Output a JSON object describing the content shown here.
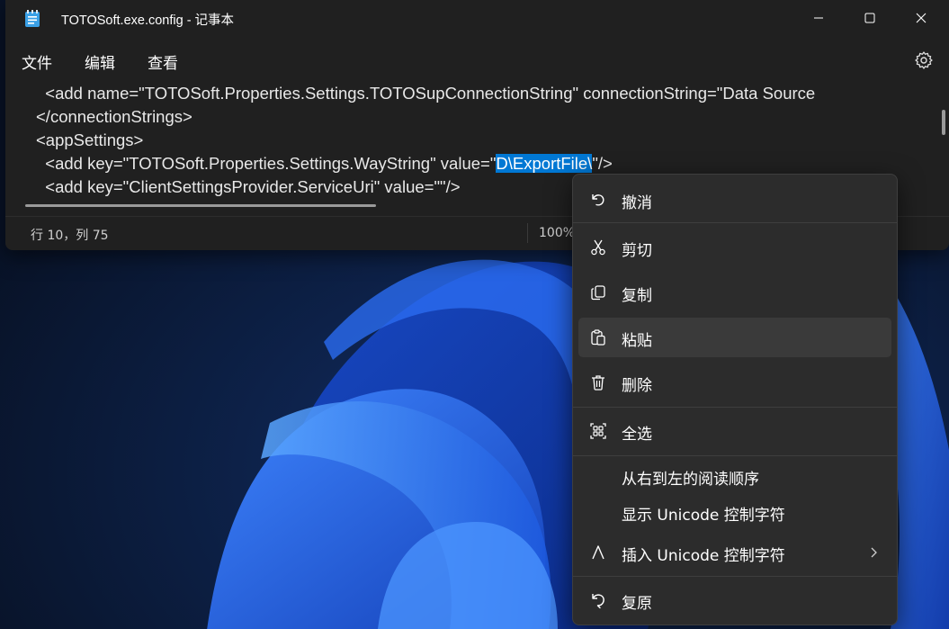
{
  "window": {
    "title": "TOTOSoft.exe.config - 记事本",
    "menu": [
      "文件",
      "编辑",
      "查看"
    ]
  },
  "editor": {
    "lines": [
      {
        "pre": "  <add name=\"TOTOSoft.Properties.Settings.TOTOSupConnectionString\" connectionString=\"Data Source",
        "sel": "",
        "post": ""
      },
      {
        "pre": "</connectionStrings>",
        "sel": "",
        "post": ""
      },
      {
        "pre": "<appSettings>",
        "sel": "",
        "post": ""
      },
      {
        "pre": "  <add key=\"TOTOSoft.Properties.Settings.WayString\" value=\"",
        "sel": "D\\ExportFile\\",
        "post": "\"/>"
      },
      {
        "pre": "  <add key=\"ClientSettingsProvider.ServiceUri\" value=\"\"/>",
        "sel": "",
        "post": ""
      }
    ]
  },
  "status": {
    "position": "行 10，列 75",
    "zoom": "100%"
  },
  "context_menu": {
    "items": [
      {
        "label": "撤消",
        "icon": "undo-icon"
      },
      {
        "label": "剪切",
        "icon": "cut-icon"
      },
      {
        "label": "复制",
        "icon": "copy-icon"
      },
      {
        "label": "粘贴",
        "icon": "paste-icon"
      },
      {
        "label": "删除",
        "icon": "delete-icon"
      },
      {
        "label": "全选",
        "icon": "select-all-icon"
      },
      {
        "label": "从右到左的阅读顺序",
        "icon": ""
      },
      {
        "label": "显示 Unicode 控制字符",
        "icon": ""
      },
      {
        "label": "插入 Unicode 控制字符",
        "icon": "insert-unicode-icon"
      },
      {
        "label": "复原",
        "icon": "reconvert-icon"
      }
    ],
    "hovered": "粘贴"
  },
  "colors": {
    "selection": "#0078d4",
    "window_bg": "#202020",
    "menu_bg": "#2c2c2c"
  }
}
